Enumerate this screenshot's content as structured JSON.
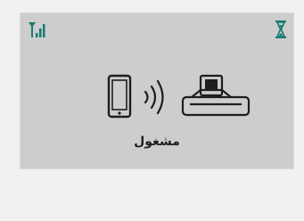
{
  "colors": {
    "page_background": "#f1f1f1",
    "panel_background": "#cdcdcd",
    "signal_icon": "#1a7a73",
    "hourglass_icon": "#1a7a73",
    "artwork": "#1e1e1e"
  },
  "status_bar": {
    "left_icon": "signal-strength-icon",
    "right_icon": "hourglass-icon"
  },
  "illustration": {
    "icons": [
      "phone-icon",
      "wireless-waves-icon",
      "printer-icon"
    ]
  },
  "status": {
    "text": "مشغول"
  }
}
